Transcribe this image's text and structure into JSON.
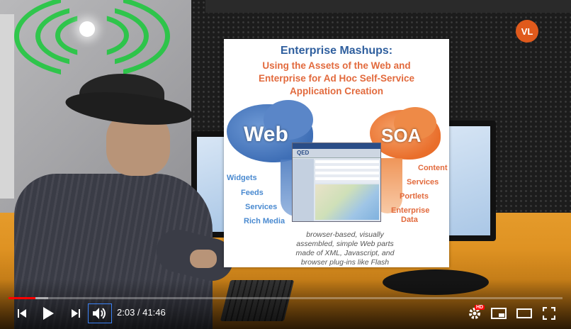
{
  "slide": {
    "title": "Enterprise Mashups:",
    "subtitle_lines": [
      "Using the Assets of the Web and",
      "Enterprise for Ad Hoc Self-Service",
      "Application Creation"
    ],
    "web_label": "Web",
    "soa_label": "SOA",
    "screenshot_logo": "QED",
    "web_items": [
      "Widgets",
      "Feeds",
      "Services",
      "Rich Media"
    ],
    "soa_items": [
      "Content",
      "Services",
      "Portlets",
      "Enterprise",
      "Data"
    ],
    "caption_lines": [
      "browser-based, visually",
      "assembled, simple Web parts",
      "made of XML, Javascript, and",
      "browser plug-ins like Flash"
    ]
  },
  "player": {
    "current_time": "2:03",
    "separator": " / ",
    "duration": "41:46",
    "played_fraction": 0.049,
    "buffered_fraction": 0.072,
    "hd_badge": "HD",
    "channel_badge": "VL",
    "controls": {
      "previous": "previous-icon",
      "play": "play-icon",
      "next": "next-icon",
      "volume": "volume-icon",
      "settings": "gear-icon",
      "miniplayer": "miniplayer-icon",
      "theater": "theater-icon",
      "fullscreen": "fullscreen-icon"
    },
    "accent_color": "#ff0000"
  }
}
